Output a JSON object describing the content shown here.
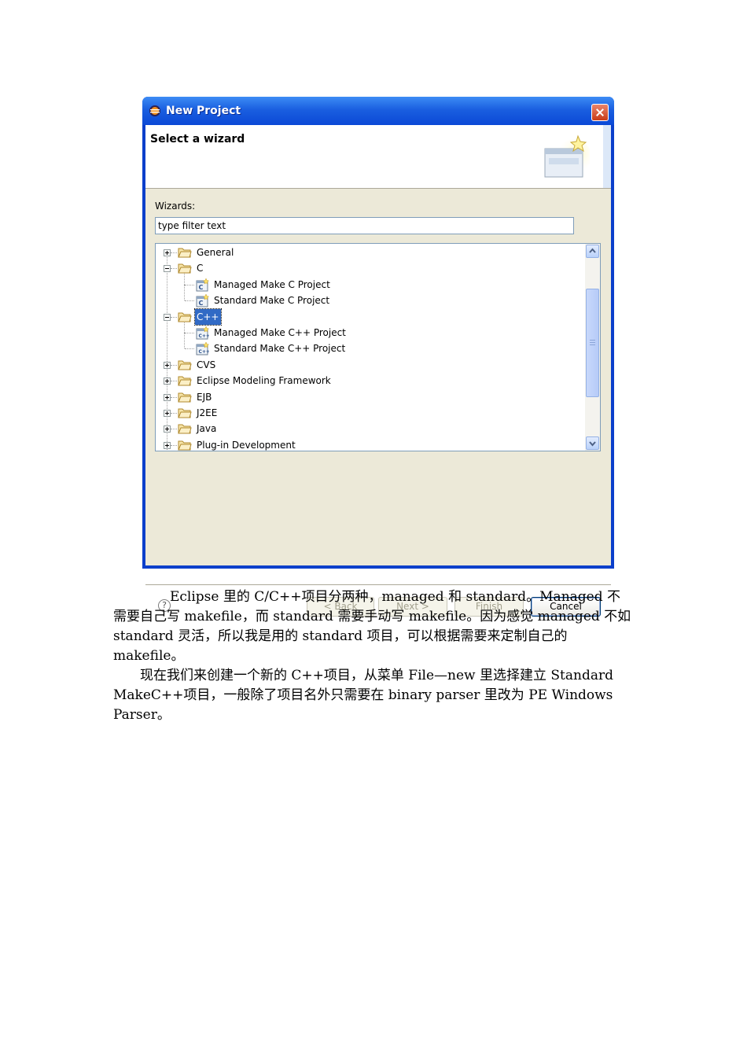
{
  "dialog": {
    "title": "New Project",
    "header_title": "Select a wizard",
    "wizards_label": "Wizards:",
    "filter_placeholder": "type filter text",
    "tree": [
      {
        "label": "General",
        "level": 0,
        "expanded": false,
        "kind": "folder"
      },
      {
        "label": "C",
        "level": 0,
        "expanded": true,
        "kind": "folder"
      },
      {
        "label": "Managed Make C Project",
        "level": 1,
        "kind": "c-project"
      },
      {
        "label": "Standard Make C Project",
        "level": 1,
        "kind": "c-project"
      },
      {
        "label": "C++",
        "level": 0,
        "expanded": true,
        "kind": "folder",
        "selected": true
      },
      {
        "label": "Managed Make C++ Project",
        "level": 1,
        "kind": "cpp-project"
      },
      {
        "label": "Standard Make C++ Project",
        "level": 1,
        "kind": "cpp-project"
      },
      {
        "label": "CVS",
        "level": 0,
        "expanded": false,
        "kind": "folder"
      },
      {
        "label": "Eclipse Modeling Framework",
        "level": 0,
        "expanded": false,
        "kind": "folder"
      },
      {
        "label": "EJB",
        "level": 0,
        "expanded": false,
        "kind": "folder"
      },
      {
        "label": "J2EE",
        "level": 0,
        "expanded": false,
        "kind": "folder"
      },
      {
        "label": "Java",
        "level": 0,
        "expanded": false,
        "kind": "folder"
      },
      {
        "label": "Plug-in Development",
        "level": 0,
        "expanded": false,
        "kind": "folder"
      }
    ],
    "buttons": {
      "help": "?",
      "back": "< Back",
      "next": "Next >",
      "finish": "Finish",
      "cancel": "Cancel"
    },
    "icons": {
      "title": "eclipse-icon",
      "close": "close-icon",
      "wizard": "new-wizard-icon",
      "folder": "folder-icon",
      "project": "project-icon"
    },
    "colors": {
      "titlebar": "#0b48d6",
      "selection": "#316ac5",
      "client": "#ece9d8"
    }
  },
  "text": {
    "paragraph1": "Eclipse 里的 C/C++项目分两种，managed 和 standard。Managed 不需要自己写 makefile，而 standard 需要手动写 makefile。因为感觉 managed 不如 standard 灵活，所以我是用的 standard 项目，可以根据需要来定制自己的 makefile。",
    "paragraph2": "现在我们来创建一个新的 C++项目，从菜单 File—new 里选择建立 Standard MakeC++项目，一般除了项目名外只需要在 binary parser 里改为 PE Windows Parser。"
  }
}
